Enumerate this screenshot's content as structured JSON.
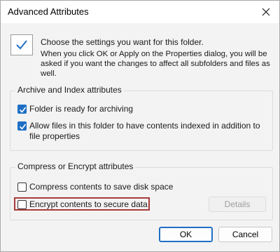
{
  "window": {
    "title": "Advanced Attributes"
  },
  "intro": {
    "choose_text": "Choose the settings you want for this folder.",
    "info_text": "When you click OK or Apply on the Properties dialog, you will be asked if you want the changes to affect all subfolders and files as well."
  },
  "archive_group": {
    "title": "Archive and Index attributes",
    "items": [
      {
        "label": "Folder is ready for archiving",
        "checked": true
      },
      {
        "label": "Allow files in this folder to have contents indexed in addition to file properties",
        "checked": true
      }
    ]
  },
  "compress_group": {
    "title": "Compress or Encrypt attributes",
    "items": [
      {
        "label": "Compress contents to save disk space",
        "checked": false
      },
      {
        "label": "Encrypt contents to secure data",
        "checked": false
      }
    ],
    "details_label": "Details"
  },
  "buttons": {
    "ok_label": "OK",
    "cancel_label": "Cancel"
  },
  "colors": {
    "accent": "#1f6fc5",
    "highlight_border": "#a93b3b"
  },
  "icons": {
    "close": "close-icon",
    "folder_check": "checkmark-icon"
  }
}
